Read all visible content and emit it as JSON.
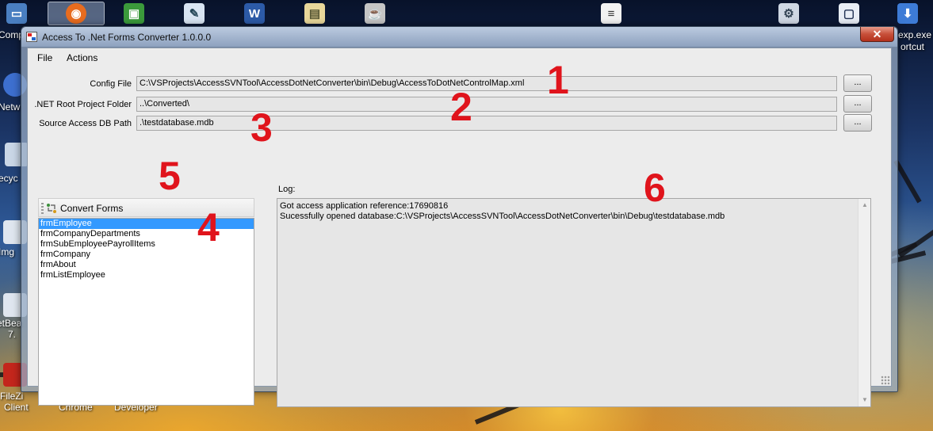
{
  "desktop": {
    "side_labels": {
      "computer": "Comp",
      "network": "Netw",
      "recycle": "ecyc",
      "img": "Img",
      "netbeans": "etBea",
      "netbeans_ver": "7.",
      "filezilla": "FileZi",
      "filezilla_2": "Client",
      "chrome": "Chrome",
      "developer": "Developer",
      "right_exp": "exp.exe",
      "right_shortcut": "ortcut"
    }
  },
  "window": {
    "title": "Access To .Net Forms Converter 1.0.0.0",
    "close_label": "✕",
    "menu": {
      "file": "File",
      "actions": "Actions"
    },
    "fields": {
      "config_file": {
        "label": "Config File",
        "value": "C:\\VSProjects\\AccessSVNTool\\AccessDotNetConverter\\bin\\Debug\\AccessToDotNetControlMap.xml"
      },
      "net_root": {
        "label": ".NET Root Project Folder",
        "value": "..\\Converted\\"
      },
      "source_db": {
        "label": "Source Access DB Path",
        "value": ".\\testdatabase.mdb"
      },
      "browse_label": "..."
    },
    "convert_button": "Convert Forms",
    "forms": [
      "frmEmployee",
      "frmCompanyDepartments",
      "frmSubEmployeePayrollItems",
      "frmCompany",
      "frmAbout",
      "frmListEmployee"
    ],
    "selected_form_index": 0,
    "log": {
      "label": "Log:",
      "lines": [
        "Got access application reference:17690816",
        "Sucessfully opened database:C:\\VSProjects\\AccessSVNTool\\AccessDotNetConverter\\bin\\Debug\\testdatabase.mdb"
      ]
    }
  },
  "annotations": [
    "1",
    "2",
    "3",
    "4",
    "5",
    "6"
  ],
  "colors": {
    "annotation": "#e0141c",
    "selection": "#3399ff",
    "close_button": "#c7503a"
  }
}
